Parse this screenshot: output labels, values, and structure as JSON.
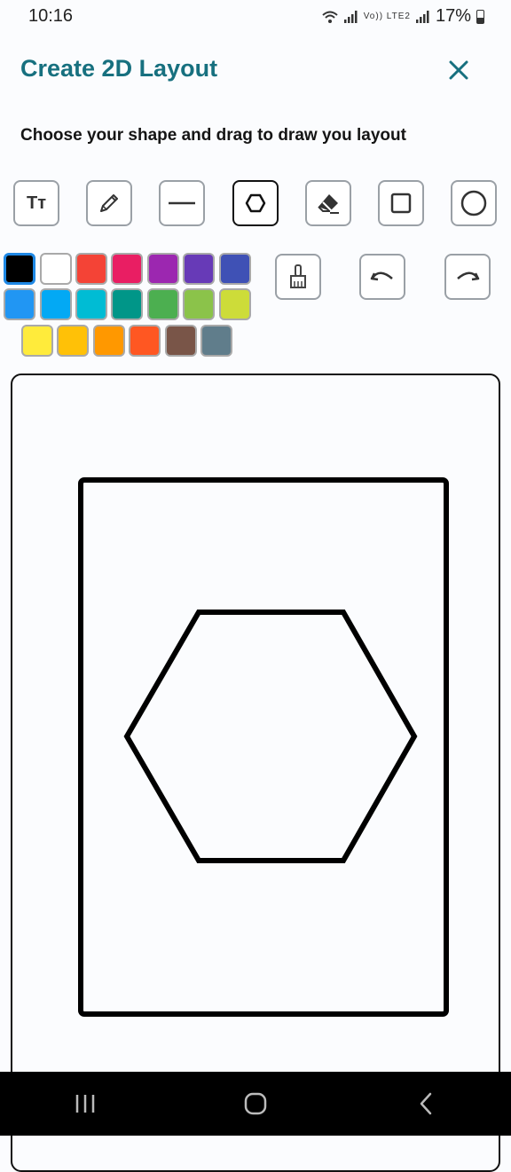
{
  "status_bar": {
    "time": "10:16",
    "network": "Vo)) LTE2",
    "battery": "17%"
  },
  "header": {
    "title": "Create 2D Layout"
  },
  "instruction": "Choose your shape and drag to draw you layout",
  "tools": [
    {
      "name": "text",
      "icon": "text-tool-icon",
      "glyph": "Tт",
      "selected": false
    },
    {
      "name": "pencil",
      "icon": "pencil-icon",
      "selected": false
    },
    {
      "name": "line",
      "icon": "line-icon",
      "selected": false
    },
    {
      "name": "hexagon",
      "icon": "hexagon-icon",
      "selected": true
    },
    {
      "name": "eraser",
      "icon": "eraser-icon",
      "selected": false
    },
    {
      "name": "square",
      "icon": "square-icon",
      "selected": false
    },
    {
      "name": "circle",
      "icon": "circle-icon",
      "selected": false
    }
  ],
  "colors": {
    "selected": "#000000",
    "palette": [
      "#000000",
      "#ffffff",
      "#f44336",
      "#e91e63",
      "#9c27b0",
      "#673ab7",
      "#3f51b5",
      "#2196f3",
      "#03a9f4",
      "#00bcd4",
      "#009688",
      "#4caf50",
      "#8bc34a",
      "#cddc39",
      "#ffeb3b",
      "#ffc107",
      "#ff9800",
      "#ff5722",
      "#795548",
      "#607d8b"
    ]
  },
  "actions": [
    {
      "name": "clear",
      "icon": "broom-icon"
    },
    {
      "name": "undo",
      "icon": "undo-icon"
    },
    {
      "name": "redo",
      "icon": "redo-icon"
    }
  ],
  "navbar": {
    "icons": [
      "recent-apps-icon",
      "home-icon",
      "back-icon"
    ]
  }
}
